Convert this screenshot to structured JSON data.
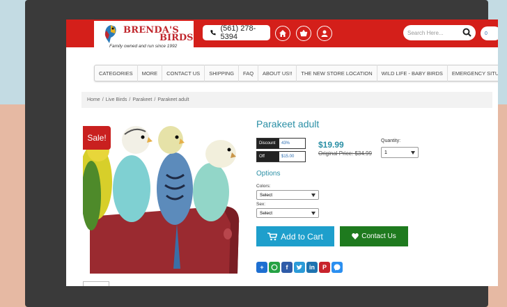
{
  "brand": {
    "name_line1": "BRENDA'S",
    "name_line2": "BIRDS",
    "tagline": "Family owned and run since 1992"
  },
  "header": {
    "phone": "(561) 278-5394",
    "search_placeholder": "Search Here...",
    "cart_count": "0"
  },
  "nav": {
    "items": [
      "CATEGORIES",
      "MORE",
      "CONTACT US",
      "SHIPPING",
      "FAQ",
      "ABOUT US!!",
      "THE NEW STORE LOCATION",
      "WILD LIFE - BABY BIRDS",
      "EMERGENCY SITUATION"
    ]
  },
  "breadcrumb": [
    "Home",
    "Live Birds",
    "Parakeet",
    "Parakeet adult"
  ],
  "product": {
    "title": "Parakeet adult",
    "sale_badge": "Sale!",
    "discount_label": "Discount",
    "discount_value": "43%",
    "off_label": "Off",
    "off_value": "$15.00",
    "price": "$19.99",
    "original_price": "Original Price: $34.99",
    "quantity_label": "Quantity:",
    "quantity_value": "1",
    "options_title": "Options",
    "colors_label": "Colors:",
    "colors_value": "Select",
    "sex_label": "Sex:",
    "sex_value": "Select",
    "add_to_cart": "Add to Cart",
    "contact_us": "Contact Us"
  },
  "share_icons": [
    "addthis-icon",
    "whatsapp-icon",
    "facebook-icon",
    "twitter-icon",
    "linkedin-icon",
    "pinterest-icon",
    "messenger-icon"
  ],
  "colors": {
    "header_red": "#d41f1a",
    "accent_teal": "#2a8fa5",
    "cart_blue": "#1e9fcc",
    "contact_green": "#1e7a1e"
  }
}
